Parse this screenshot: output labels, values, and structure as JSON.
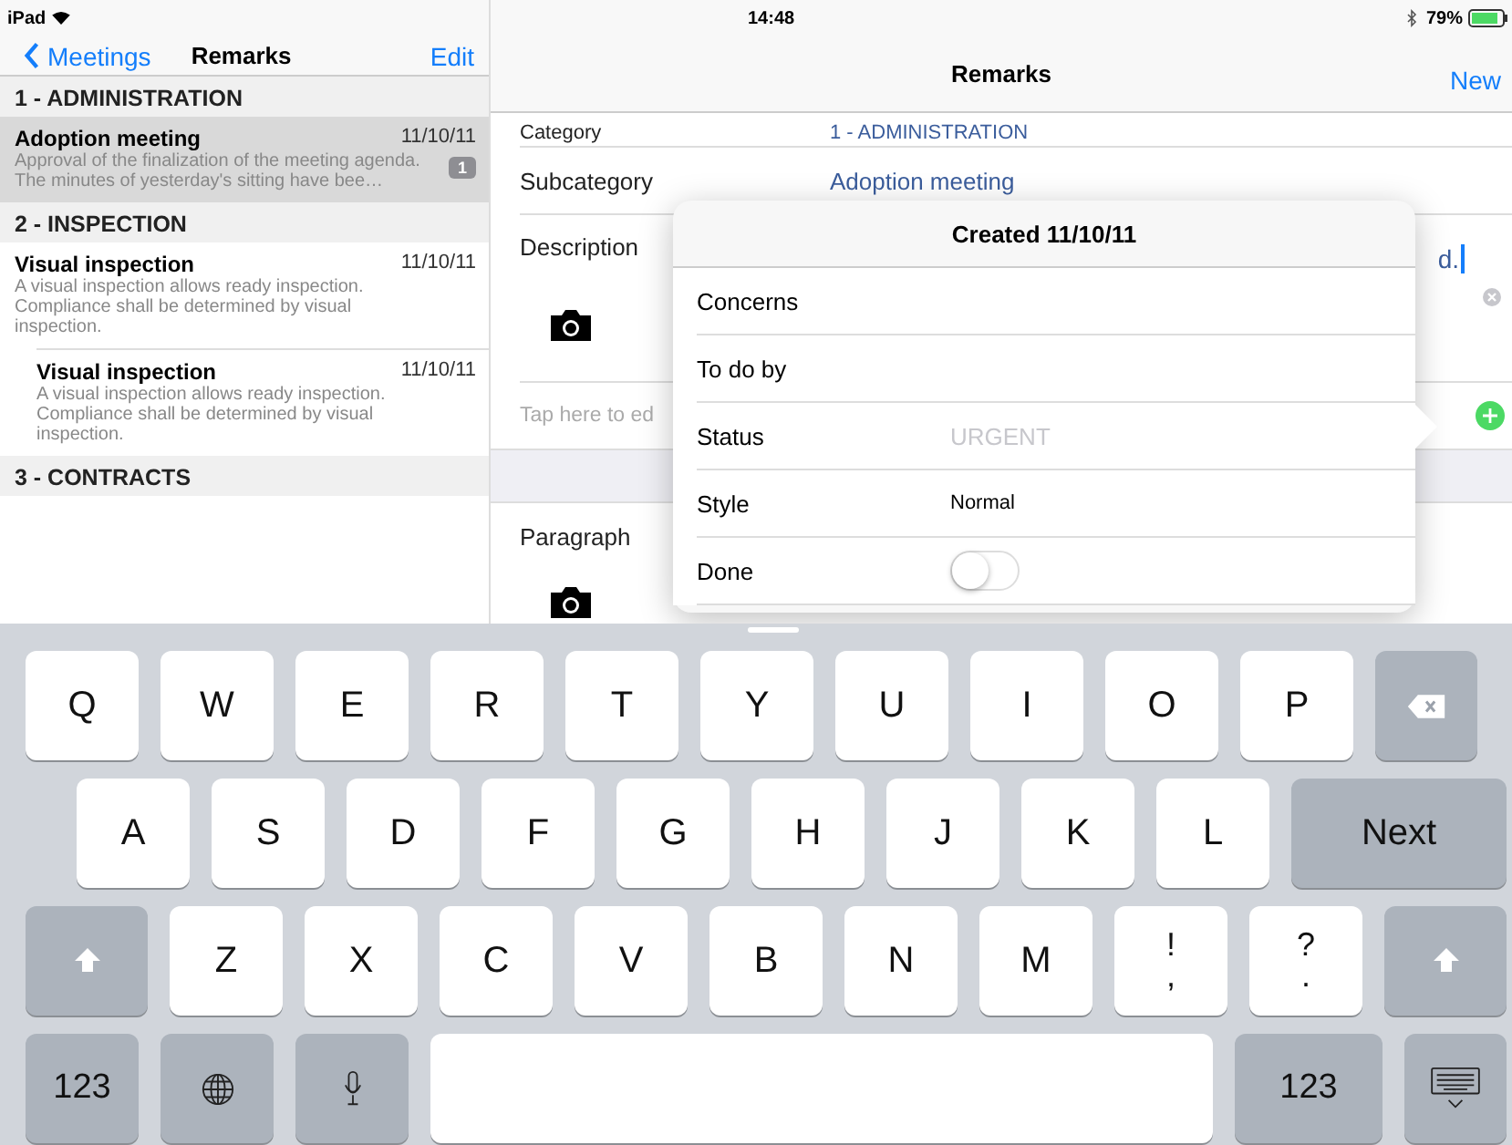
{
  "status_bar": {
    "device": "iPad",
    "time": "14:48",
    "battery_percent": "79%"
  },
  "master": {
    "back": "Meetings",
    "title": "Remarks",
    "action": "Edit",
    "sections": [
      {
        "title": "1 - ADMINISTRATION",
        "items": [
          {
            "title": "Adoption meeting",
            "date": "11/10/11",
            "preview": "Approval of the finalization of the meeting agenda.\nThe minutes of yesterday's sitting have bee…",
            "badge": "1",
            "selected": true
          }
        ]
      },
      {
        "title": "2 - INSPECTION",
        "items": [
          {
            "title": "Visual inspection",
            "date": "11/10/11",
            "preview": "A visual inspection allows ready inspection. Compliance shall be determined by visual inspection.",
            "selected": false
          },
          {
            "title": "Visual inspection",
            "date": "11/10/11",
            "preview": "A visual inspection allows ready inspection. Compliance shall be determined by visual inspection.",
            "selected": false
          }
        ]
      },
      {
        "title": "3 - CONTRACTS"
      }
    ]
  },
  "detail": {
    "title": "Remarks",
    "action": "New",
    "fields": [
      {
        "label": "Category",
        "value": "1 - ADMINISTRATION"
      },
      {
        "label": "Subcategory",
        "value": "Adoption meeting"
      }
    ],
    "description": {
      "label": "Description",
      "value_tail": "d."
    },
    "note_placeholder": "Tap here to ed",
    "paragraph": {
      "label": "Paragraph"
    }
  },
  "popover": {
    "title": "Created 11/10/11",
    "rows": [
      {
        "kind": "text",
        "label": "Concerns"
      },
      {
        "kind": "text",
        "label": "To do by"
      },
      {
        "kind": "placeholder",
        "label": "Status",
        "placeholder": "URGENT"
      },
      {
        "kind": "text",
        "label": "Style",
        "value": "Normal"
      },
      {
        "kind": "switch",
        "label": "Done",
        "on": false
      }
    ]
  },
  "keyboard": {
    "key_rows": [
      {
        "keys": [
          {
            "kind": "letter",
            "label": "Q"
          },
          {
            "kind": "letter",
            "label": "W"
          },
          {
            "kind": "letter",
            "label": "E"
          },
          {
            "kind": "letter",
            "label": "R"
          },
          {
            "kind": "letter",
            "label": "T"
          },
          {
            "kind": "letter",
            "label": "Y"
          },
          {
            "kind": "letter",
            "label": "U"
          },
          {
            "kind": "letter",
            "label": "I"
          },
          {
            "kind": "letter",
            "label": "O"
          },
          {
            "kind": "letter",
            "label": "P"
          },
          {
            "kind": "backspace"
          }
        ]
      },
      {
        "keys": [
          {
            "kind": "letter",
            "label": "A"
          },
          {
            "kind": "letter",
            "label": "S"
          },
          {
            "kind": "letter",
            "label": "D"
          },
          {
            "kind": "letter",
            "label": "F"
          },
          {
            "kind": "letter",
            "label": "G"
          },
          {
            "kind": "letter",
            "label": "H"
          },
          {
            "kind": "letter",
            "label": "J"
          },
          {
            "kind": "letter",
            "label": "K"
          },
          {
            "kind": "letter",
            "label": "L"
          },
          {
            "kind": "action",
            "label": "Next"
          }
        ]
      },
      {
        "keys": [
          {
            "kind": "shift"
          },
          {
            "kind": "letter",
            "label": "Z"
          },
          {
            "kind": "letter",
            "label": "X"
          },
          {
            "kind": "letter",
            "label": "C"
          },
          {
            "kind": "letter",
            "label": "V"
          },
          {
            "kind": "letter",
            "label": "B"
          },
          {
            "kind": "letter",
            "label": "N"
          },
          {
            "kind": "letter",
            "label": "M"
          },
          {
            "kind": "punct",
            "label": "!",
            "sub": ","
          },
          {
            "kind": "punct",
            "label": "?",
            "sub": "."
          },
          {
            "kind": "shift"
          }
        ]
      },
      {
        "keys": [
          {
            "kind": "number",
            "label": "123"
          },
          {
            "kind": "globe"
          },
          {
            "kind": "mic"
          },
          {
            "kind": "space"
          },
          {
            "kind": "number",
            "label": "123"
          },
          {
            "kind": "hide"
          }
        ]
      }
    ]
  }
}
